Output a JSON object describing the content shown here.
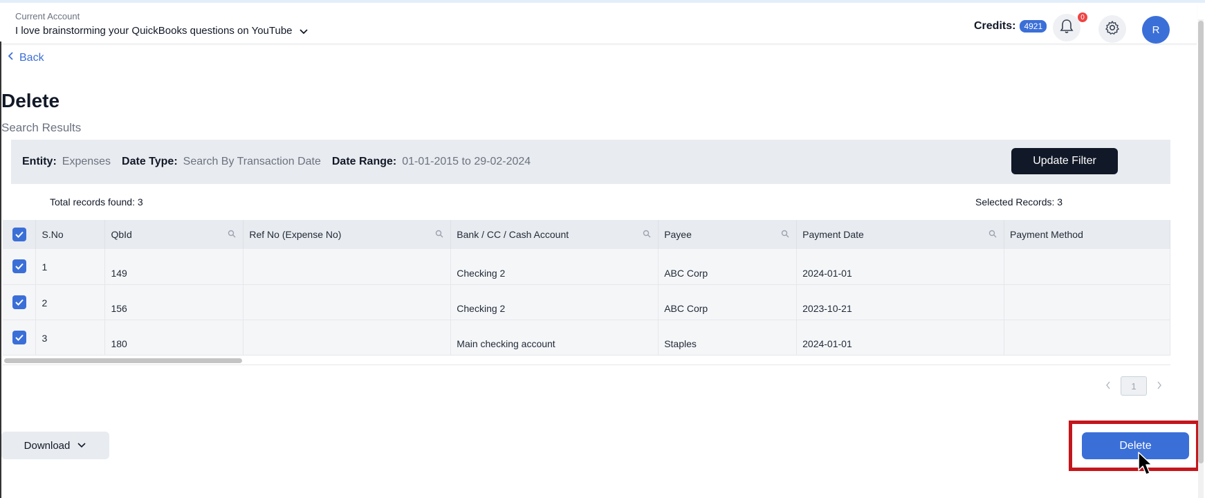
{
  "header": {
    "account_caption": "Current Account",
    "account_name": "I love brainstorming your QuickBooks questions on YouTube",
    "credits_label": "Credits:",
    "credits_value": "4921",
    "notification_count": "0",
    "avatar_initial": "R"
  },
  "nav": {
    "back_label": "Back"
  },
  "page": {
    "title": "Delete",
    "subtitle": "Search Results"
  },
  "filter": {
    "entity_label": "Entity:",
    "entity_value": "Expenses",
    "date_type_label": "Date Type:",
    "date_type_value": "Search By Transaction Date",
    "date_range_label": "Date Range:",
    "date_range_value": "01-01-2015 to 29-02-2024",
    "update_button": "Update Filter"
  },
  "summary": {
    "total_records": "Total records found: 3",
    "selected_records": "Selected Records: 3"
  },
  "table": {
    "columns": [
      "S.No",
      "QbId",
      "Ref No (Expense No)",
      "Bank / CC / Cash Account",
      "Payee",
      "Payment Date",
      "Payment Method"
    ],
    "rows": [
      {
        "sno": "1",
        "qbid": "149",
        "ref_no": "",
        "account": "Checking 2",
        "payee": "ABC Corp",
        "payment_date": "2024-01-01",
        "payment_method": ""
      },
      {
        "sno": "2",
        "qbid": "156",
        "ref_no": "",
        "account": "Checking 2",
        "payee": "ABC Corp",
        "payment_date": "2023-10-21",
        "payment_method": ""
      },
      {
        "sno": "3",
        "qbid": "180",
        "ref_no": "",
        "account": "Main checking account",
        "payee": "Staples",
        "payment_date": "2024-01-01",
        "payment_method": ""
      }
    ]
  },
  "pagination": {
    "current_page": "1"
  },
  "actions": {
    "download_label": "Download",
    "delete_label": "Delete"
  },
  "colors": {
    "accent": "#3b6fd8",
    "highlight": "#c4161c",
    "dark_button": "#111827"
  }
}
